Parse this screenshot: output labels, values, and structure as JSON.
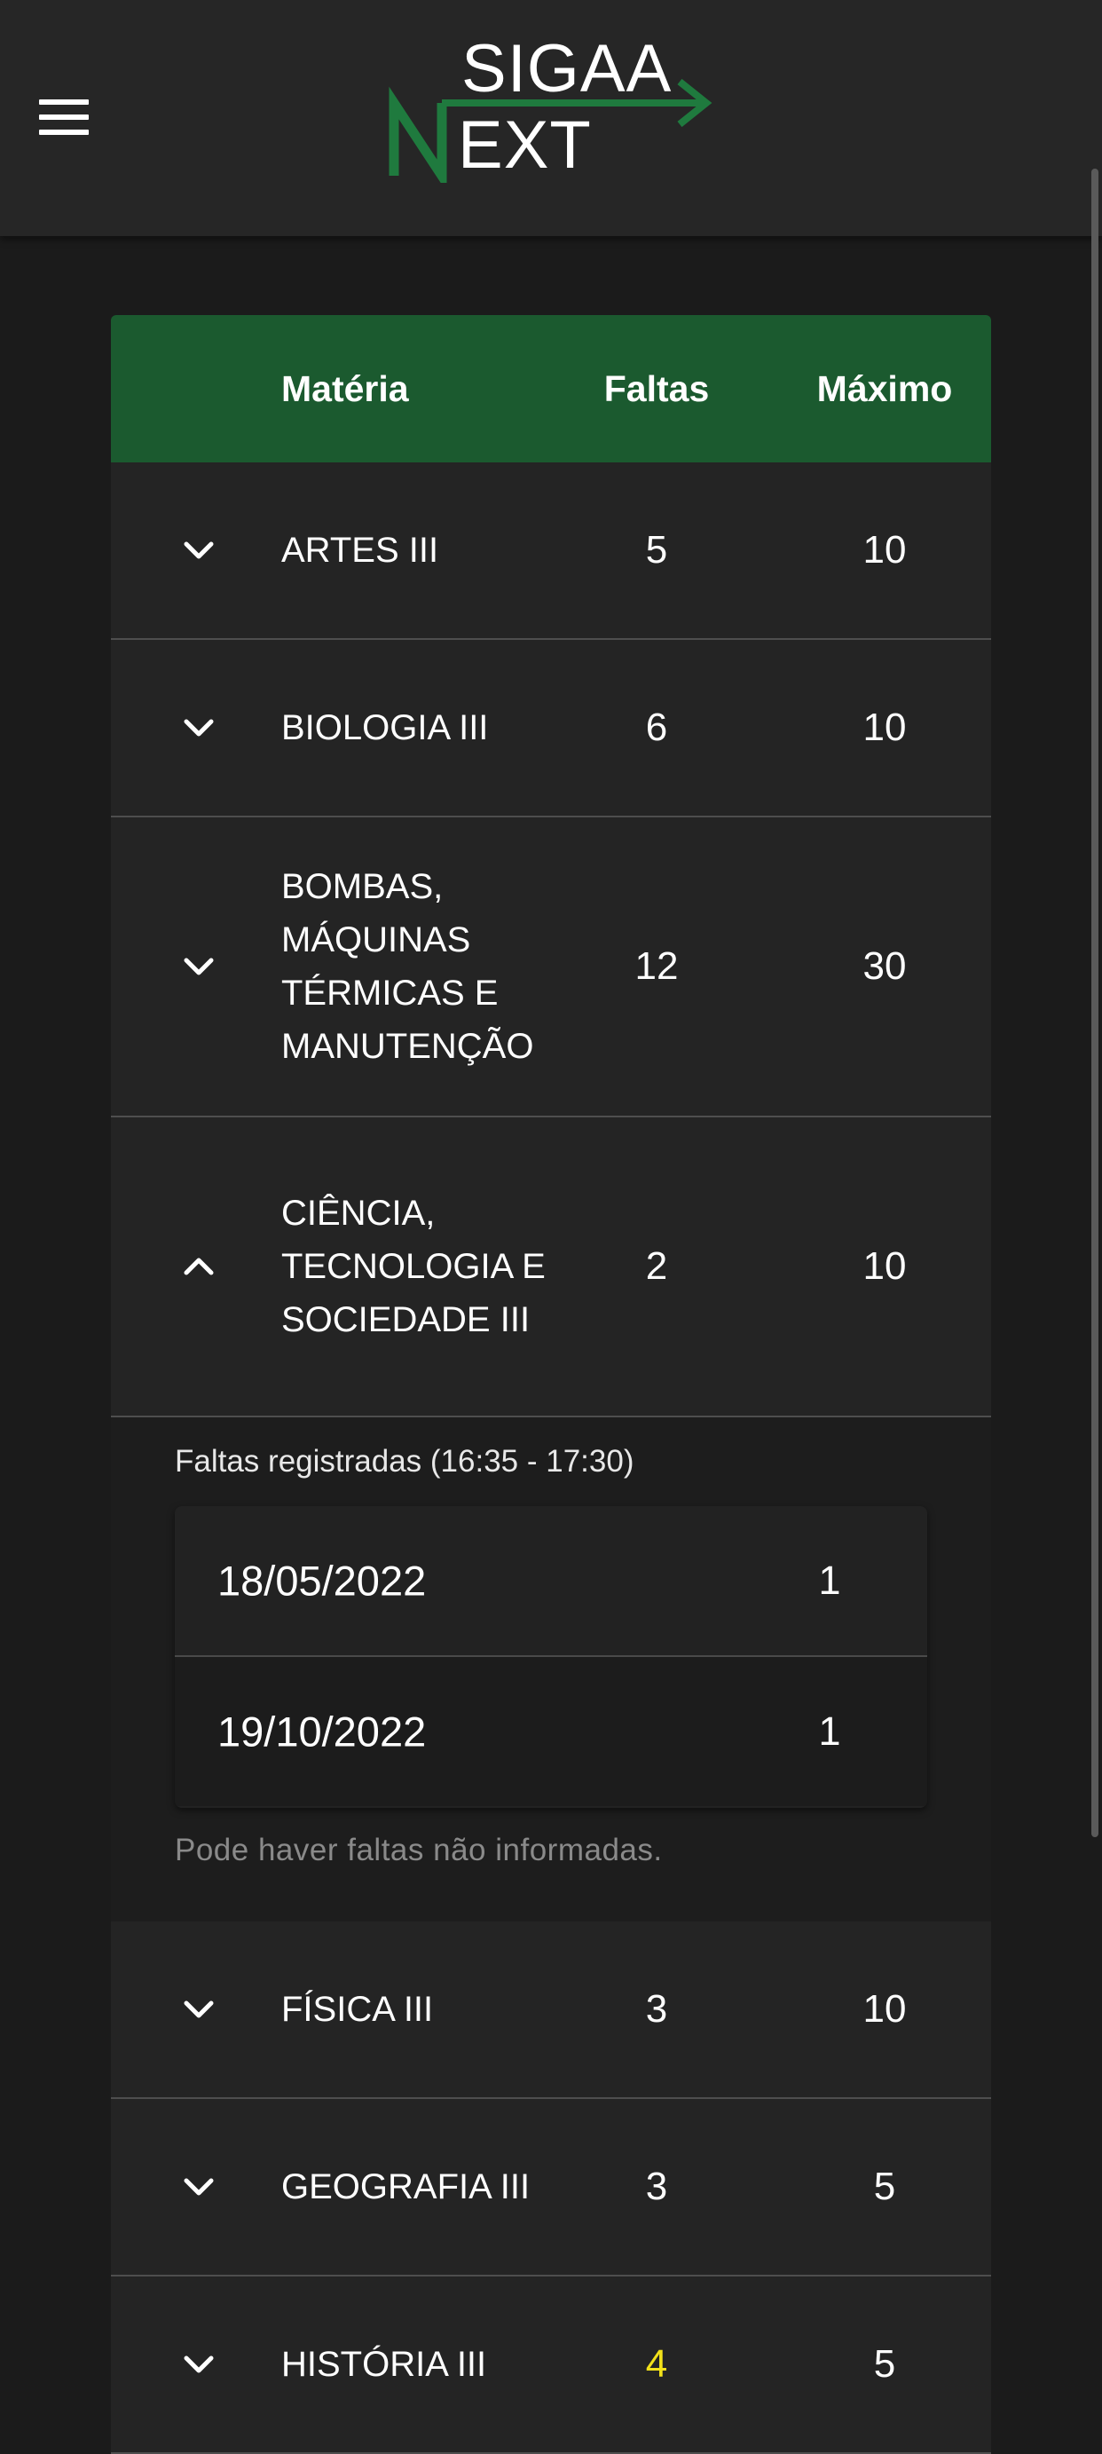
{
  "header": {
    "logo_top": "SIGAA",
    "logo_bottom": "EXT",
    "logo_accent_letter": "N",
    "brand_color": "#1f7a3e"
  },
  "table": {
    "columns": {
      "materia": "Matéria",
      "faltas": "Faltas",
      "maximo": "Máximo"
    },
    "rows": [
      {
        "name": "ARTES III",
        "faltas": "5",
        "maximo": "10",
        "expanded": false
      },
      {
        "name": "BIOLOGIA III",
        "faltas": "6",
        "maximo": "10",
        "expanded": false
      },
      {
        "name": "BOMBAS, MÁQUINAS TÉRMICAS E MANUTENÇÃO",
        "faltas": "12",
        "maximo": "30",
        "expanded": false
      },
      {
        "name": "CIÊNCIA, TECNOLOGIA E SOCIEDADE III",
        "faltas": "2",
        "maximo": "10",
        "expanded": true
      },
      {
        "name": "FÍSICA III",
        "faltas": "3",
        "maximo": "10",
        "expanded": false
      },
      {
        "name": "GEOGRAFIA III",
        "faltas": "3",
        "maximo": "5",
        "expanded": false
      },
      {
        "name": "HISTÓRIA III",
        "faltas": "4",
        "maximo": "5",
        "expanded": false,
        "warning": true
      }
    ],
    "expanded_detail": {
      "title": "Faltas registradas (16:35 - 17:30)",
      "entries": [
        {
          "date": "18/05/2022",
          "count": "1"
        },
        {
          "date": "19/10/2022",
          "count": "1"
        }
      ],
      "note": "Pode haver faltas não informadas."
    }
  },
  "colors": {
    "header_green": "#1b5a2f",
    "warning_yellow": "#f2e11a",
    "background": "#1b1b1b"
  }
}
